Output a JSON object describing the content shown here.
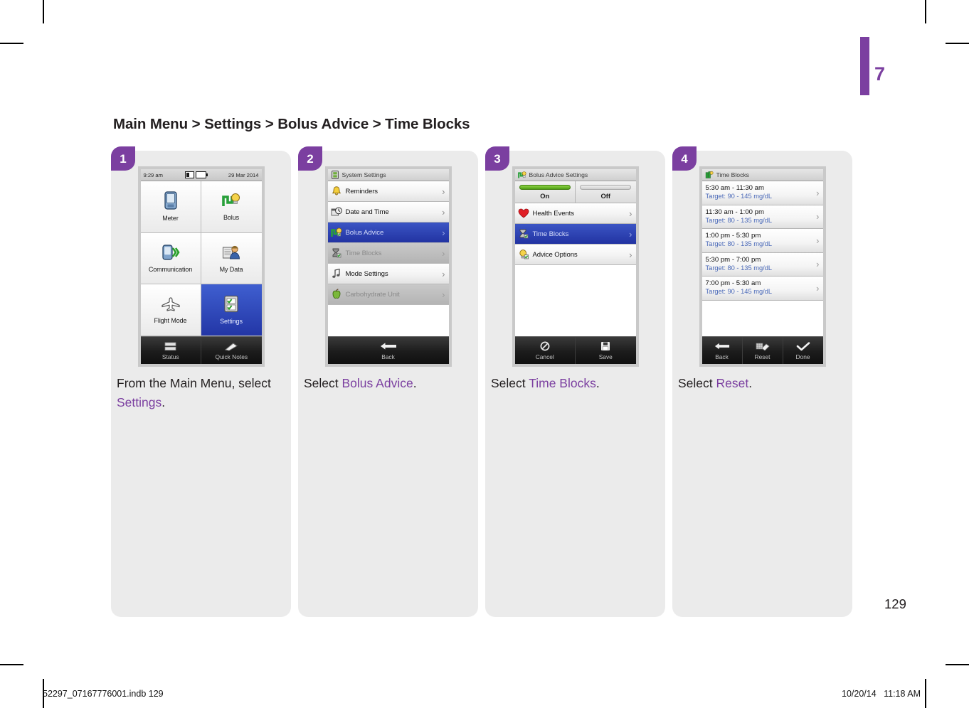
{
  "document": {
    "chapter_number": "7",
    "page_number": "129",
    "breadcrumb": "Main Menu > Settings > Bolus Advice > Time Blocks",
    "accent_color": "#7b3fa0",
    "footer_left": "52297_07167776001.indb   129",
    "footer_date": "10/20/14",
    "footer_time": "11:18 AM"
  },
  "steps": [
    {
      "number": "1",
      "caption_pre": "From the Main Menu, select ",
      "caption_highlight": "Settings",
      "caption_post": ".",
      "screen": {
        "type": "main-menu",
        "statusbar": {
          "time": "9:29 am",
          "date": "29 Mar 2014",
          "icons": [
            "sd-card-icon",
            "battery-icon"
          ]
        },
        "tiles": [
          {
            "label": "Meter",
            "icon": "meter-device-icon",
            "selected": false
          },
          {
            "label": "Bolus",
            "icon": "bolus-bulb-icon",
            "selected": false
          },
          {
            "label": "Communication",
            "icon": "communication-icon",
            "selected": false
          },
          {
            "label": "My Data",
            "icon": "my-data-person-icon",
            "selected": false
          },
          {
            "label": "Flight Mode",
            "icon": "airplane-icon",
            "selected": false
          },
          {
            "label": "Settings",
            "icon": "settings-checklist-icon",
            "selected": true
          }
        ],
        "toolbar": [
          {
            "label": "Status",
            "icon": "status-bars-icon"
          },
          {
            "label": "Quick Notes",
            "icon": "quick-notes-pencil-icon"
          }
        ]
      }
    },
    {
      "number": "2",
      "caption_pre": "Select ",
      "caption_highlight": "Bolus Advice",
      "caption_post": ".",
      "screen": {
        "type": "list",
        "header": {
          "title": "System Settings",
          "icon": "system-settings-icon"
        },
        "rows": [
          {
            "label": "Reminders",
            "icon": "bell-icon",
            "state": "normal"
          },
          {
            "label": "Date and Time",
            "icon": "calendar-clock-icon",
            "state": "normal"
          },
          {
            "label": "Bolus Advice",
            "icon": "bolus-advice-icon",
            "state": "selected"
          },
          {
            "label": "Time Blocks",
            "icon": "time-blocks-icon",
            "state": "dimmed"
          },
          {
            "label": "Mode Settings",
            "icon": "music-note-icon",
            "state": "normal"
          },
          {
            "label": "Carbohydrate Unit",
            "icon": "apple-icon",
            "state": "dimmed"
          }
        ],
        "toolbar": [
          {
            "label": "Back",
            "icon": "back-arrow-icon"
          }
        ]
      }
    },
    {
      "number": "3",
      "caption_pre": "Select ",
      "caption_highlight": "Time Blocks",
      "caption_post": ".",
      "screen": {
        "type": "list-with-toggle",
        "header": {
          "title": "Bolus Advice Settings",
          "icon": "bolus-advice-icon"
        },
        "toggle": {
          "on_label": "On",
          "off_label": "Off",
          "value": "On"
        },
        "rows": [
          {
            "label": "Health Events",
            "icon": "heart-icon",
            "state": "normal"
          },
          {
            "label": "Time Blocks",
            "icon": "time-blocks-icon",
            "state": "selected"
          },
          {
            "label": "Advice Options",
            "icon": "advice-bulb-icon",
            "state": "normal"
          }
        ],
        "toolbar": [
          {
            "label": "Cancel",
            "icon": "cancel-icon"
          },
          {
            "label": "Save",
            "icon": "save-disk-icon"
          }
        ]
      }
    },
    {
      "number": "4",
      "caption_pre": "Select ",
      "caption_highlight": "Reset",
      "caption_post": ".",
      "screen": {
        "type": "time-block-list",
        "header": {
          "title": "Time Blocks",
          "icon": "time-blocks-header-icon"
        },
        "blocks": [
          {
            "range": "5:30 am - 11:30 am",
            "target": "Target: 90 - 145 mg/dL"
          },
          {
            "range": "11:30 am - 1:00 pm",
            "target": "Target: 80 - 135 mg/dL"
          },
          {
            "range": "1:00 pm - 5:30 pm",
            "target": "Target: 80 - 135 mg/dL"
          },
          {
            "range": "5:30 pm - 7:00 pm",
            "target": "Target: 80 - 135 mg/dL"
          },
          {
            "range": "7:00 pm - 5:30 am",
            "target": "Target: 90 - 145 mg/dL"
          }
        ],
        "toolbar": [
          {
            "label": "Back",
            "icon": "back-arrow-icon"
          },
          {
            "label": "Reset",
            "icon": "reset-eraser-icon"
          },
          {
            "label": "Done",
            "icon": "checkmark-icon"
          }
        ]
      }
    }
  ]
}
